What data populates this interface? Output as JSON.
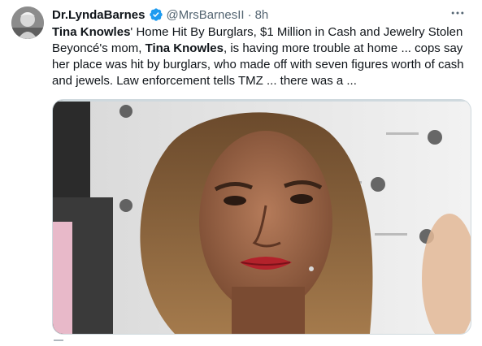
{
  "tweet": {
    "author": {
      "display_name": "Dr.LyndaBarnes",
      "handle": "@MrsBarnesII",
      "verified_color": "#1d9bf0"
    },
    "separator": "·",
    "time": "8h",
    "more_icon": "more-horizontal-icon",
    "text": {
      "p1_bold": "Tina Knowles",
      "p1_rest": "' Home Hit By Burglars, $1 Million in Cash and Jewelry Stolen",
      "p2_start": "Beyoncé's mom, ",
      "p2_bold": "Tina Knowles",
      "p2_rest": ", is having more trouble at home ... cops say her place was hit by burglars, who made off with seven figures worth of cash and jewels. Law enforcement tells TMZ ... there was a ..."
    }
  }
}
